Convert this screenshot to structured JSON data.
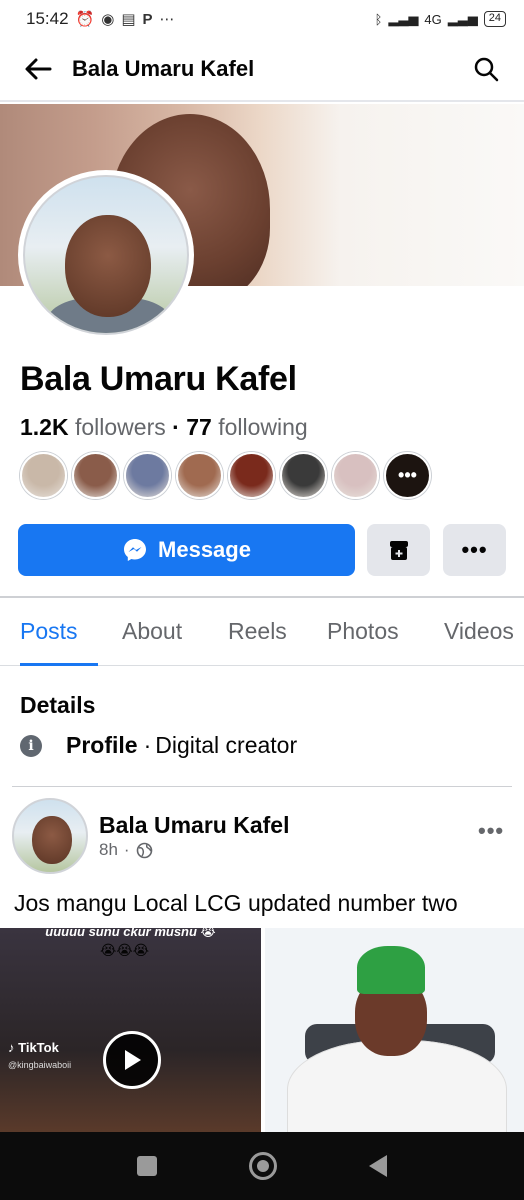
{
  "status_bar": {
    "time": "15:42",
    "left_icons": [
      "alarm-icon",
      "whatsapp-icon",
      "message-icon",
      "p-icon",
      "more-dots"
    ],
    "network": "4G",
    "battery": "24"
  },
  "top_bar": {
    "title": "Bala Umaru Kafel",
    "back_icon": "arrow-left-icon",
    "search_icon": "search-icon"
  },
  "profile": {
    "name": "Bala Umaru Kafel",
    "followers_count": "1.2K",
    "followers_label": "followers",
    "separator": "·",
    "following_count": "77",
    "following_label": "following",
    "follower_avatar_colors": [
      "#c9b8a8",
      "#8a5c4a",
      "#6d7aa0",
      "#a06a50",
      "#7a2a1c",
      "#3a3a3a",
      "#d8c0c0"
    ],
    "more_followers_label": "•••"
  },
  "actions": {
    "message_label": "Message",
    "message_color": "#1877f2"
  },
  "tabs": [
    {
      "label": "Posts",
      "active": true
    },
    {
      "label": "About",
      "active": false
    },
    {
      "label": "Reels",
      "active": false
    },
    {
      "label": "Photos",
      "active": false
    },
    {
      "label": "Videos",
      "active": false
    }
  ],
  "details": {
    "title": "Details",
    "label": "Profile",
    "separator": "·",
    "value": "Digital creator"
  },
  "post": {
    "author": "Bala Umaru Kafel",
    "time": "8h",
    "separator": "·",
    "text": "Jos mangu Local LCG updated number two",
    "video_caption": "uuuuu sunu ckur musnu 😭",
    "video_emojis": "😭😭😭",
    "tiktok_label": "TikTok",
    "tiktok_handle": "@kingbaiwaboii"
  }
}
